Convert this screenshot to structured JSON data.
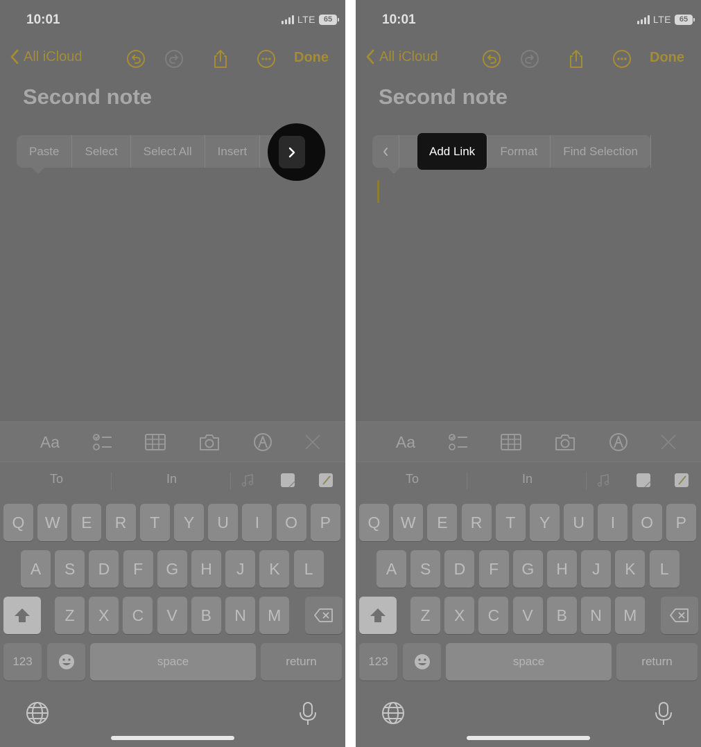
{
  "status": {
    "time": "10:01",
    "network": "LTE",
    "battery": "65"
  },
  "nav": {
    "back_label": "All iCloud",
    "done_label": "Done"
  },
  "note": {
    "title": "Second note"
  },
  "left_menu": {
    "items": [
      "Paste",
      "Select",
      "Select All",
      "Insert"
    ]
  },
  "right_menu": {
    "items": [
      "Add Link",
      "Format",
      "Find Selection"
    ]
  },
  "toolbar": {
    "format_label": "Aa"
  },
  "predictions": [
    "To",
    "In"
  ],
  "keys": {
    "row1": [
      "Q",
      "W",
      "E",
      "R",
      "T",
      "Y",
      "U",
      "I",
      "O",
      "P"
    ],
    "row2": [
      "A",
      "S",
      "D",
      "F",
      "G",
      "H",
      "J",
      "K",
      "L"
    ],
    "row3": [
      "Z",
      "X",
      "C",
      "V",
      "B",
      "N",
      "M"
    ],
    "numbers_label": "123",
    "space_label": "space",
    "return_label": "return"
  },
  "colors": {
    "background": "#6b6b6b",
    "accent": "#a58d35",
    "highlight": "#0c0c0c"
  },
  "icons": [
    "chevron-left-icon",
    "undo-icon",
    "redo-icon",
    "share-icon",
    "more-icon",
    "checklist-icon",
    "table-icon",
    "camera-icon",
    "markup-icon",
    "close-icon",
    "globe-icon",
    "microphone-icon",
    "shift-icon",
    "delete-icon",
    "emoji-icon",
    "chevron-right-icon"
  ]
}
